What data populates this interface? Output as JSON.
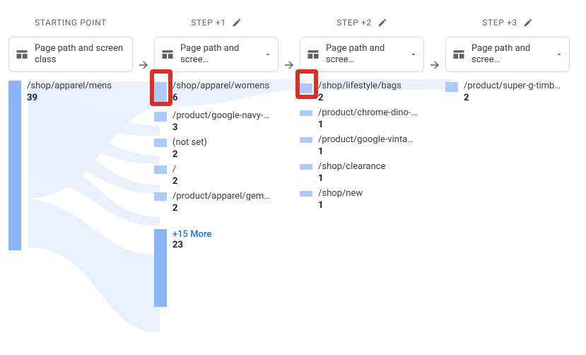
{
  "headers": {
    "starting": "STARTING POINT",
    "step1": "STEP +1",
    "step2": "STEP +2",
    "step3": "STEP +3"
  },
  "dimension": {
    "label_full": "Page path and screen class",
    "label_trunc": "Page path and scree…"
  },
  "col0": {
    "items": [
      {
        "path": "/shop/apparel/mens",
        "count": "39",
        "barH": 240
      }
    ]
  },
  "col1": {
    "items": [
      {
        "path": "/shop/apparel/womens",
        "count": "6",
        "barH": 34
      },
      {
        "path": "/product/google-navy-…",
        "count": "3",
        "barH": 14
      },
      {
        "path": "(not set)",
        "count": "2",
        "barH": 12
      },
      {
        "path": "/",
        "count": "2",
        "barH": 12
      },
      {
        "path": "/product/apparel/gem…",
        "count": "2",
        "barH": 12
      }
    ],
    "more": {
      "label": "+15 More",
      "count": "23",
      "barH": 110
    }
  },
  "col2": {
    "items": [
      {
        "path": "/shop/lifestyle/bags",
        "count": "2",
        "barH": 14
      },
      {
        "path": "/product/chrome-dino-…",
        "count": "1",
        "barH": 8
      },
      {
        "path": "/product/google-vinta…",
        "count": "1",
        "barH": 8
      },
      {
        "path": "/shop/clearance",
        "count": "1",
        "barH": 8
      },
      {
        "path": "/shop/new",
        "count": "1",
        "barH": 8
      }
    ]
  },
  "col3": {
    "items": [
      {
        "path": "/product/super-g-timb…",
        "count": "2",
        "barH": 14
      }
    ]
  }
}
